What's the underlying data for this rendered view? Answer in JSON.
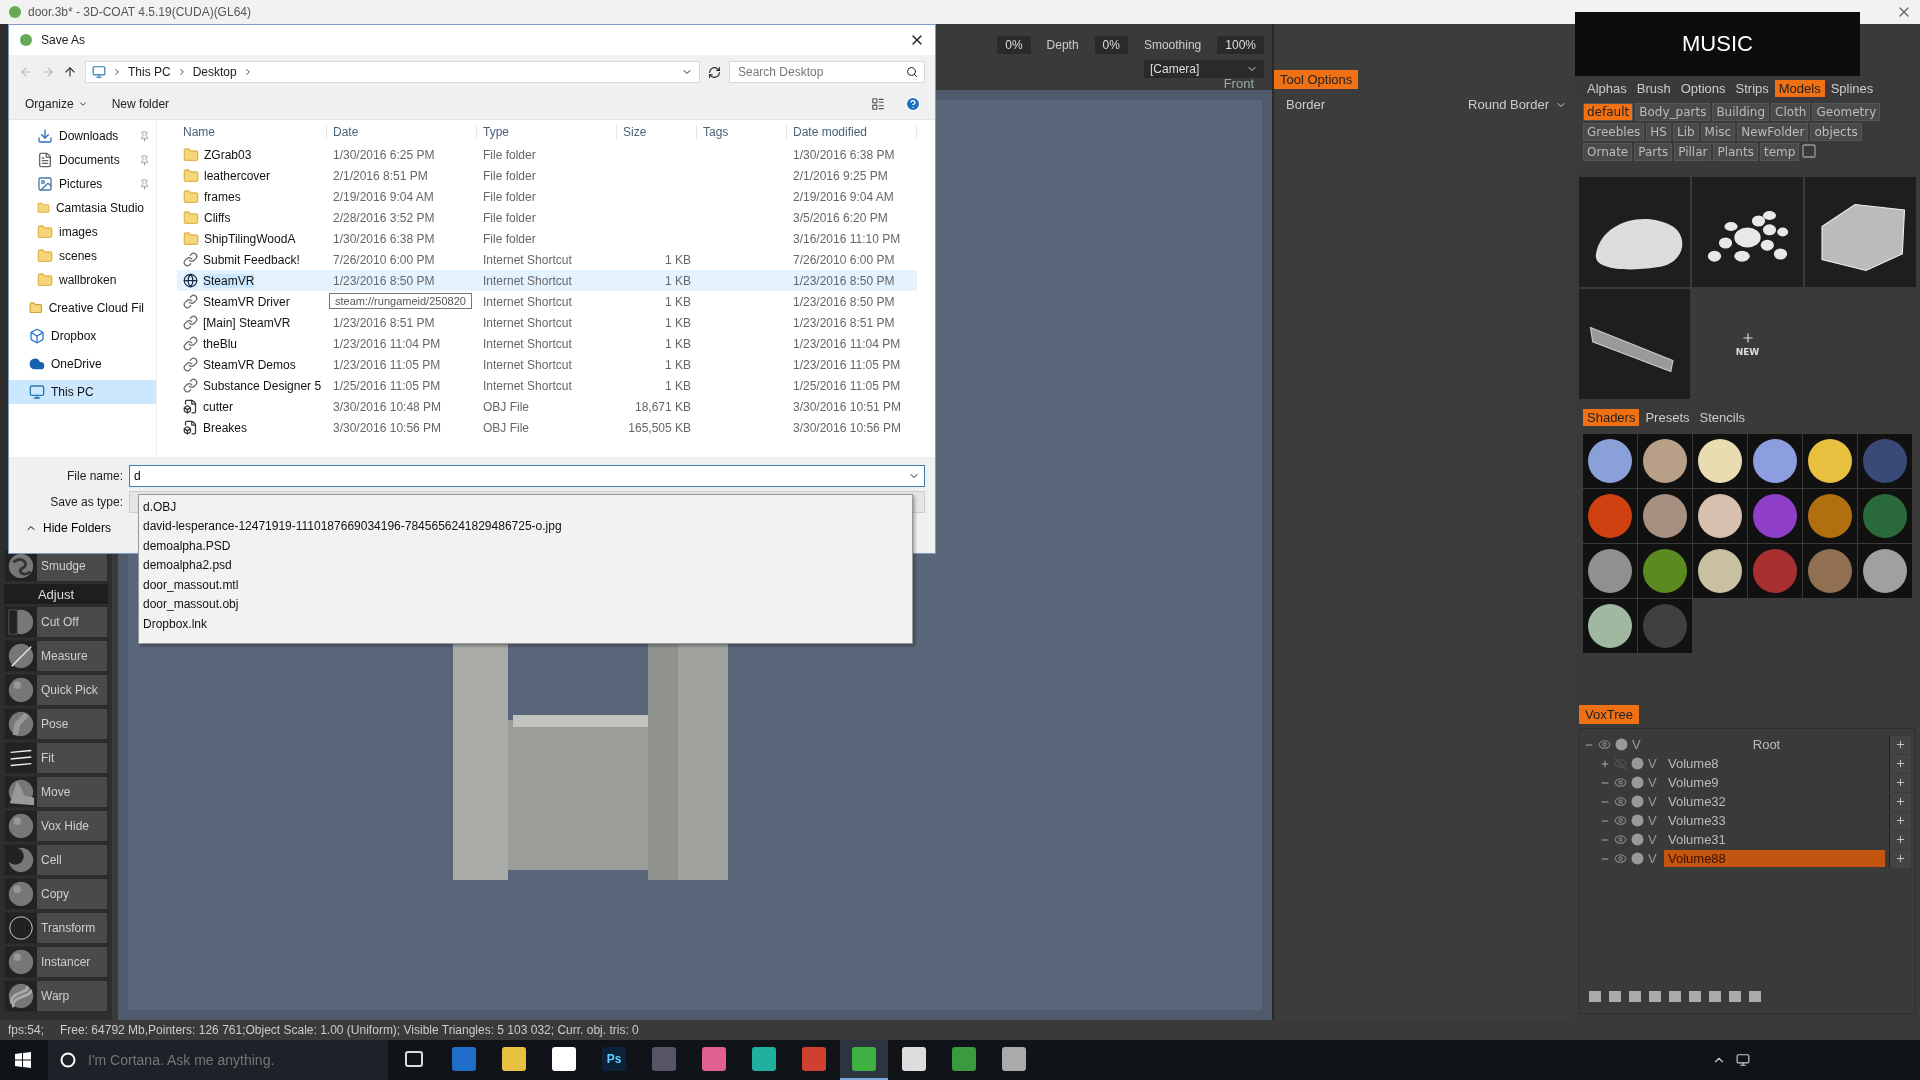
{
  "app_title": "door.3b* - 3D-COAT 4.5.19(CUDA)(GL64)",
  "toolbar": {
    "items": [
      {
        "kind": "value",
        "text": "0%"
      },
      {
        "kind": "label",
        "text": "Depth"
      },
      {
        "kind": "value",
        "text": "0%"
      },
      {
        "kind": "label",
        "text": "Smoothing"
      },
      {
        "kind": "value",
        "text": "100%"
      }
    ],
    "camera": "[Camera]",
    "view_label": "Front"
  },
  "tool_options": {
    "title": "Tool Options",
    "border_label": "Border",
    "border_value": "Round Border"
  },
  "overlay_label": "MUSIC",
  "library": {
    "tabs": [
      {
        "label": "Alphas",
        "selected": false
      },
      {
        "label": "Brush",
        "selected": false
      },
      {
        "label": "Options",
        "selected": false
      },
      {
        "label": "Strips",
        "selected": false
      },
      {
        "label": "Models",
        "selected": true
      },
      {
        "label": "Splines",
        "selected": false
      }
    ],
    "folders": [
      {
        "label": "default",
        "selected": true
      },
      {
        "label": "Body_parts",
        "selected": false
      },
      {
        "label": "Building",
        "selected": false
      },
      {
        "label": "Cloth",
        "selected": false
      },
      {
        "label": "Geometry",
        "selected": false
      },
      {
        "label": "Greebles",
        "selected": false
      },
      {
        "label": "HS",
        "selected": false
      },
      {
        "label": "Lib",
        "selected": false
      },
      {
        "label": "Misc",
        "selected": false
      },
      {
        "label": "NewFolder",
        "selected": false
      },
      {
        "label": "objects",
        "selected": false
      },
      {
        "label": "Ornate",
        "selected": false
      },
      {
        "label": "Parts",
        "selected": false
      },
      {
        "label": "Pillar",
        "selected": false
      },
      {
        "label": "Plants",
        "selected": false
      },
      {
        "label": "temp",
        "selected": false
      }
    ],
    "models": [
      {
        "kind": "rock"
      },
      {
        "kind": "pebbles"
      },
      {
        "kind": "block"
      },
      {
        "kind": "plank"
      }
    ],
    "new_label": "NEW"
  },
  "shader_panel": {
    "tabs": [
      {
        "label": "Shaders",
        "selected": true
      },
      {
        "label": "Presets",
        "selected": false
      },
      {
        "label": "Stencils",
        "selected": false
      }
    ],
    "shaders": [
      {
        "color": "#8aa0d8"
      },
      {
        "color": "#b8a088"
      },
      {
        "color": "#e8dcb0"
      },
      {
        "color": "#8c9ee0"
      },
      {
        "color": "#e8c040"
      },
      {
        "color": "#3a4a78"
      },
      {
        "color": "#d04010"
      },
      {
        "color": "#a89080"
      },
      {
        "color": "#d8c0b0"
      },
      {
        "color": "#9040c8"
      },
      {
        "color": "#b07010"
      },
      {
        "color": "#2a6a3a"
      },
      {
        "color": "#909090"
      },
      {
        "color": "#5a8a20"
      },
      {
        "color": "#c8c0a0"
      },
      {
        "color": "#a83030"
      },
      {
        "color": "#907050"
      },
      {
        "color": "#a0a0a0"
      },
      {
        "color": "#a0b8a0"
      },
      {
        "color": "#404040"
      }
    ]
  },
  "voxtree": {
    "title": "VoxTree",
    "root": {
      "name": "Root",
      "flag": "V",
      "expanded": true,
      "visible": true,
      "children": [
        {
          "name": "Volume8",
          "flag": "V",
          "expanded": false,
          "visible": false,
          "selected": false
        },
        {
          "name": "Volume9",
          "flag": "V",
          "expanded": true,
          "visible": true,
          "selected": false
        },
        {
          "name": "Volume32",
          "flag": "V",
          "expanded": true,
          "visible": true,
          "selected": false
        },
        {
          "name": "Volume33",
          "flag": "V",
          "expanded": true,
          "visible": true,
          "selected": false
        },
        {
          "name": "Volume31",
          "flag": "V",
          "expanded": true,
          "visible": true,
          "selected": false
        },
        {
          "name": "Volume88",
          "flag": "V",
          "expanded": true,
          "visible": true,
          "selected": true
        }
      ]
    }
  },
  "tools": {
    "top": [
      {
        "label": "Smudge",
        "kind": "smudge"
      }
    ],
    "section": "Adjust",
    "items": [
      {
        "label": "Cut Off",
        "kind": "cut"
      },
      {
        "label": "Measure",
        "kind": "measure"
      },
      {
        "label": "Quick Pick",
        "kind": "sphere"
      },
      {
        "label": "Pose",
        "kind": "pose"
      },
      {
        "label": "Fit",
        "kind": "fit"
      },
      {
        "label": "Move",
        "kind": "move"
      },
      {
        "label": "Vox Hide",
        "kind": "sphere"
      },
      {
        "label": "Cell",
        "kind": "cell"
      },
      {
        "label": "Copy",
        "kind": "sphere"
      },
      {
        "label": "Transform",
        "kind": "transform"
      },
      {
        "label": "Instancer",
        "kind": "sphere"
      },
      {
        "label": "Warp",
        "kind": "warp"
      }
    ]
  },
  "dialog": {
    "title": "Save As",
    "path": [
      "This PC",
      "Desktop"
    ],
    "search_placeholder": "Search Desktop",
    "organize": "Organize",
    "new_folder": "New folder",
    "nav": [
      {
        "label": "Downloads",
        "kind": "downloads",
        "pinned": true,
        "selected": false
      },
      {
        "label": "Documents",
        "kind": "documents",
        "pinned": true,
        "selected": false
      },
      {
        "label": "Pictures",
        "kind": "pictures",
        "pinned": true,
        "selected": false
      },
      {
        "label": "Camtasia Studio",
        "kind": "folder",
        "pinned": false,
        "selected": false
      },
      {
        "label": "images",
        "kind": "folder",
        "pinned": false,
        "selected": false
      },
      {
        "label": "scenes",
        "kind": "folder",
        "pinned": false,
        "selected": false
      },
      {
        "label": "wallbroken",
        "kind": "folder",
        "pinned": false,
        "selected": false
      },
      {
        "label": "Creative Cloud Fil",
        "kind": "cloudfiles",
        "pinned": false,
        "selected": false
      },
      {
        "label": "Dropbox",
        "kind": "dropbox",
        "pinned": false,
        "selected": false
      },
      {
        "label": "OneDrive",
        "kind": "onedrive",
        "pinned": false,
        "selected": false
      },
      {
        "label": "This PC",
        "kind": "pc",
        "pinned": false,
        "selected": true
      }
    ],
    "columns": [
      "Name",
      "Date",
      "Type",
      "Size",
      "Tags",
      "Date modified"
    ],
    "files": [
      {
        "name": "ZGrab03",
        "kind": "folder",
        "date": "1/30/2016 6:25 PM",
        "type": "File folder",
        "modified": "1/30/2016 6:38 PM",
        "selected": false
      },
      {
        "name": "leathercover",
        "kind": "folder",
        "date": "2/1/2016 8:51 PM",
        "type": "File folder",
        "modified": "2/1/2016 9:25 PM",
        "selected": false
      },
      {
        "name": "frames",
        "kind": "folder",
        "date": "2/19/2016 9:04 AM",
        "type": "File folder",
        "modified": "2/19/2016 9:04 AM",
        "selected": false
      },
      {
        "name": "Cliffs",
        "kind": "folder",
        "date": "2/28/2016 3:52 PM",
        "type": "File folder",
        "modified": "3/5/2016 6:20 PM",
        "selected": false
      },
      {
        "name": "ShipTilingWoodA",
        "kind": "folder",
        "date": "1/30/2016 6:38 PM",
        "type": "File folder",
        "modified": "3/16/2016 11:10 PM",
        "selected": false
      },
      {
        "name": "Submit Feedback!",
        "kind": "shortcut",
        "date": "7/26/2010 6:00 PM",
        "type": "Internet Shortcut",
        "size": "1 KB",
        "modified": "7/26/2010 6:00 PM",
        "selected": false
      },
      {
        "name": "SteamVR",
        "kind": "steam",
        "date": "1/23/2016 8:50 PM",
        "type": "Internet Shortcut",
        "size": "1 KB",
        "modified": "1/23/2016 8:50 PM",
        "selected": true
      },
      {
        "name": "SteamVR Driver",
        "kind": "shortcut",
        "tooltip": "steam://rungameid/250820",
        "type": "Internet Shortcut",
        "size": "1 KB",
        "modified": "1/23/2016 8:50 PM",
        "selected": false
      },
      {
        "name": "[Main] SteamVR",
        "kind": "shortcut",
        "date": "1/23/2016 8:51 PM",
        "type": "Internet Shortcut",
        "size": "1 KB",
        "modified": "1/23/2016 8:51 PM",
        "selected": false
      },
      {
        "name": "theBlu",
        "kind": "shortcut",
        "date": "1/23/2016 11:04 PM",
        "type": "Internet Shortcut",
        "size": "1 KB",
        "modified": "1/23/2016 11:04 PM",
        "selected": false
      },
      {
        "name": "SteamVR Demos",
        "kind": "shortcut",
        "date": "1/23/2016 11:05 PM",
        "type": "Internet Shortcut",
        "size": "1 KB",
        "modified": "1/23/2016 11:05 PM",
        "selected": false
      },
      {
        "name": "Substance Designer 5",
        "kind": "shortcut",
        "date": "1/25/2016 11:05 PM",
        "type": "Internet Shortcut",
        "size": "1 KB",
        "modified": "1/25/2016 11:05 PM",
        "selected": false
      },
      {
        "name": "cutter",
        "kind": "obj",
        "date": "3/30/2016 10:48 PM",
        "type": "OBJ File",
        "size": "18,671 KB",
        "modified": "3/30/2016 10:51 PM",
        "selected": false
      },
      {
        "name": "Breakes",
        "kind": "obj",
        "date": "3/30/2016 10:56 PM",
        "type": "OBJ File",
        "size": "165,505 KB",
        "modified": "3/30/2016 10:56 PM",
        "selected": false
      }
    ],
    "file_name_label": "File name:",
    "file_name": "d",
    "save_type_label": "Save as type:",
    "suggestions": [
      "d.OBJ",
      "david-lesperance-12471919-1110187669034196-7845656241829486725-o.jpg",
      "demoalpha.PSD",
      "demoalpha2.psd",
      "door_massout.mtl",
      "door_massout.obj",
      "Dropbox.lnk"
    ],
    "hide_folders": "Hide Folders"
  },
  "status_bar": {
    "fps": "fps:54;",
    "info": "Free: 64792 Mb,Pointers: 126 761;Object Scale: 1.00 (Uniform); Visible Triangles: 5 103 032; Curr. obj. tris: 0"
  },
  "taskbar": {
    "search_placeholder": "I'm Cortana. Ask me anything.",
    "apps": [
      {
        "kind": "taskview",
        "active": false
      },
      {
        "kind": "edge",
        "active": false
      },
      {
        "kind": "explorer",
        "active": false
      },
      {
        "kind": "store",
        "active": false
      },
      {
        "kind": "photoshop",
        "label": "Ps",
        "active": false
      },
      {
        "kind": "disc",
        "active": false
      },
      {
        "kind": "music",
        "active": false
      },
      {
        "kind": "teal",
        "active": false
      },
      {
        "kind": "chrome",
        "active": false
      },
      {
        "kind": "coat",
        "active": true
      },
      {
        "kind": "sculpt",
        "active": false
      },
      {
        "kind": "camtasia",
        "active": false
      },
      {
        "kind": "printer",
        "active": false
      }
    ]
  }
}
